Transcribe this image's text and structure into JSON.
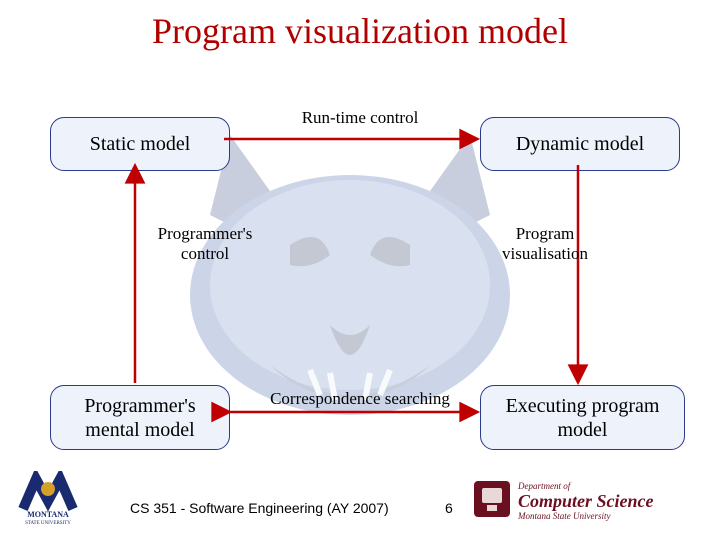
{
  "title": "Program visualization model",
  "boxes": {
    "static_model": "Static model",
    "dynamic_model": "Dynamic model",
    "programmers_mental_model": "Programmer's mental model",
    "executing_program_model": "Executing program model"
  },
  "edges": {
    "runtime_control": "Run-time control",
    "programmers_control": "Programmer's control",
    "program_visualisation": "Program visualisation",
    "correspondence_searching": "Correspondence searching"
  },
  "footer": {
    "course": "CS 351 - Software Engineering (AY 2007)",
    "page": "6",
    "dept_top": "Department of",
    "dept_main": "Computer Science",
    "dept_sub": "Montana State University",
    "univ_top": "MONTANA",
    "univ_sub": "STATE UNIVERSITY"
  },
  "colors": {
    "arrow": "#c00000",
    "box_border": "#2a3b8f",
    "title": "#b00000"
  }
}
